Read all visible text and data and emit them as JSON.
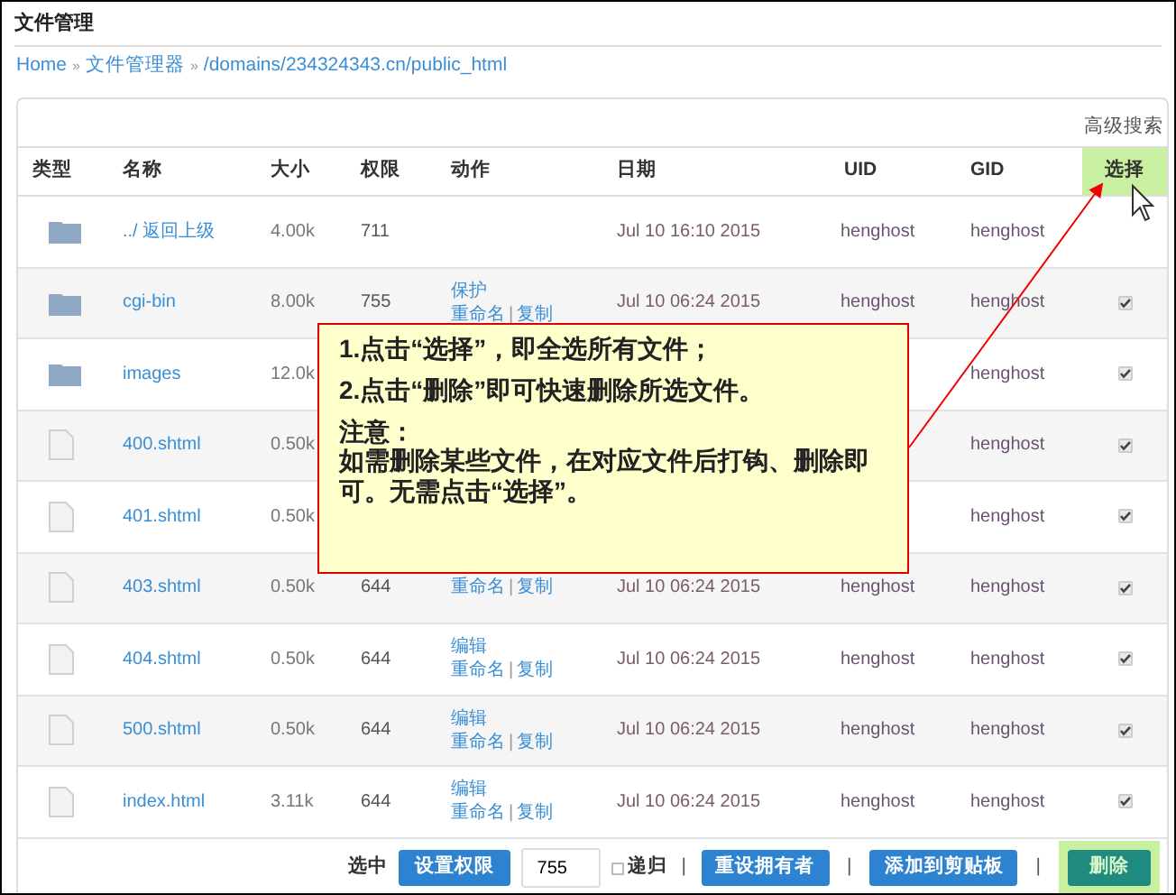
{
  "title": "文件管理",
  "breadcrumb": [
    "Home",
    "文件管理器",
    "/domains/234324343.cn/public_html"
  ],
  "breadcrumb_separator": "»",
  "advanced_search": "高级搜索",
  "columns": [
    "类型",
    "名称",
    "大小",
    "权限",
    "动作",
    "日期",
    "UID",
    "GID",
    "选择"
  ],
  "select_header_highlighted": true,
  "rows": [
    {
      "kind": "folder",
      "name": "../ 返回上级",
      "size": "4.00k",
      "perm": "711",
      "date": "Jul 10 16:10 2015",
      "uid": "henghost",
      "gid": "henghost"
    },
    {
      "kind": "folder",
      "name": "cgi-bin",
      "size": "8.00k",
      "perm": "755",
      "action": "保护",
      "links": [
        "重命名",
        "复制"
      ],
      "date": "Jul 10 06:24 2015",
      "uid": "henghost",
      "gid": "henghost",
      "checked": true
    },
    {
      "kind": "folder",
      "name": "images",
      "size": "12.0k",
      "gid": "henghost",
      "checked": true
    },
    {
      "kind": "file",
      "name": "400.shtml",
      "size": "0.50k",
      "gid": "henghost",
      "checked": true
    },
    {
      "kind": "file",
      "name": "401.shtml",
      "size": "0.50k",
      "gid": "henghost",
      "checked": true
    },
    {
      "kind": "file",
      "name": "403.shtml",
      "size": "0.50k",
      "perm": "644",
      "links": [
        "重命名",
        "复制"
      ],
      "date": "Jul 10 06:24 2015",
      "uid": "henghost",
      "gid": "henghost",
      "checked": true
    },
    {
      "kind": "file",
      "name": "404.shtml",
      "size": "0.50k",
      "perm": "644",
      "action": "编辑",
      "links": [
        "重命名",
        "复制"
      ],
      "date": "Jul 10 06:24 2015",
      "uid": "henghost",
      "gid": "henghost",
      "checked": true
    },
    {
      "kind": "file",
      "name": "500.shtml",
      "size": "0.50k",
      "perm": "644",
      "action": "编辑",
      "links": [
        "重命名",
        "复制"
      ],
      "date": "Jul 10 06:24 2015",
      "uid": "henghost",
      "gid": "henghost",
      "checked": true
    },
    {
      "kind": "file",
      "name": "index.html",
      "size": "3.11k",
      "perm": "644",
      "action": "编辑",
      "links": [
        "重命名",
        "复制"
      ],
      "date": "Jul 10 06:24 2015",
      "uid": "henghost",
      "gid": "henghost",
      "checked": true
    }
  ],
  "footer": {
    "label": "选中",
    "set_perm": "设置权限",
    "perm_value": "755",
    "recursive": {
      "label": "递归",
      "checked": false
    },
    "separator": "|",
    "reset_owner": "重设拥有者",
    "clipboard": "添加到剪贴板",
    "delete": "删除",
    "delete_highlighted": true
  },
  "callout": {
    "lines": [
      "1.点击“选择”，即全选所有文件；",
      "2.点击“删除”即可快速删除所选文件。"
    ],
    "note_title": "注意：",
    "note": "如需删除某些文件，在对应文件后打钩、删除即可。无需点击“选择”。"
  }
}
